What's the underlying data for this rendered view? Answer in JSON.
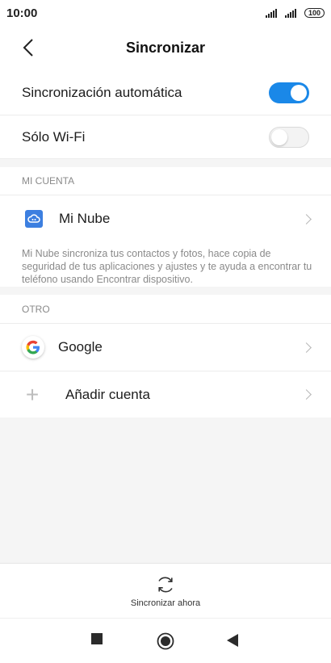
{
  "status_bar": {
    "time": "10:00",
    "battery": "100"
  },
  "header": {
    "title": "Sincronizar",
    "back_icon": "chevron-left-icon"
  },
  "settings": {
    "auto_sync": {
      "label": "Sincronización automática",
      "enabled": true
    },
    "wifi_only": {
      "label": "Sólo Wi-Fi",
      "enabled": false
    }
  },
  "my_account": {
    "section_title": "MI CUENTA",
    "items": [
      {
        "label": "Mi Nube",
        "icon": "cloud-icon"
      }
    ],
    "description": "Mi Nube sincroniza tus contactos y fotos, hace copia de seguridad de tus aplicaciones y ajustes y te ayuda a encontrar tu teléfono usando Encontrar dispositivo."
  },
  "other": {
    "section_title": "OTRO",
    "items": [
      {
        "label": "Google",
        "icon": "google-icon"
      },
      {
        "label": "Añadir cuenta",
        "icon": "plus-icon"
      }
    ]
  },
  "bottom_action": {
    "label": "Sincronizar ahora",
    "icon": "sync-icon"
  },
  "colors": {
    "accent": "#1a88e8",
    "background_gray": "#f5f5f5",
    "cloud_icon": "#3c7fe0"
  }
}
